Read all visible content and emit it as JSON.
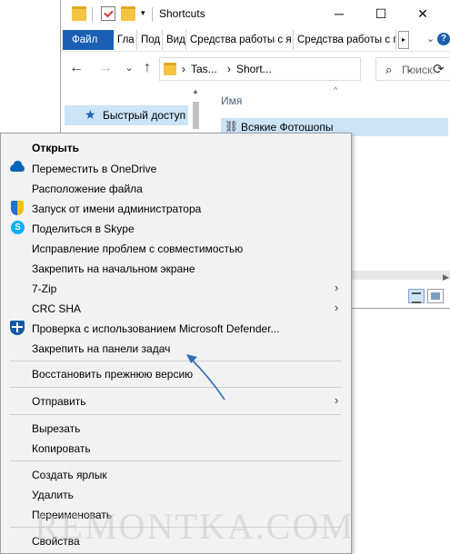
{
  "window": {
    "title": "Shortcuts",
    "minimize_glyph": "─",
    "maximize_glyph": "☐",
    "close_glyph": "✕",
    "dropdown_glyph": "▾"
  },
  "ribbon": {
    "tabs": [
      "Файл",
      "Гла",
      "Под",
      "Вид",
      "Средства работы с я",
      "Средства работы с п"
    ],
    "scroll_glyph": "▸",
    "collapse_glyph": "⌄",
    "help_glyph": "?"
  },
  "navigation": {
    "back_glyph": "←",
    "forward_glyph": "→",
    "history_glyph": "⌄",
    "up_glyph": "↑",
    "breadcrumb": [
      "Tas...",
      "Short..."
    ],
    "breadcrumb_sep": "›",
    "address_dropdown_glyph": "⌄",
    "refresh_glyph": "⟳",
    "search_placeholder": "Поиск:",
    "search_glyph": "⌕"
  },
  "nav_pane": {
    "quick_access": "Быстрый доступ"
  },
  "file_list": {
    "column_name": "Имя",
    "sort_glyph": "^",
    "selected_file": "Всякие Фотошопы"
  },
  "context_menu": {
    "items": [
      {
        "label": "Открыть",
        "icon": "",
        "submenu": false
      },
      {
        "label": "Переместить в OneDrive",
        "icon": "onedrive-icon",
        "submenu": false
      },
      {
        "label": "Расположение файла",
        "icon": "",
        "submenu": false
      },
      {
        "label": "Запуск от имени администратора",
        "icon": "uac-shield-icon",
        "submenu": false
      },
      {
        "label": "Поделиться в Skype",
        "icon": "skype-icon",
        "submenu": false
      },
      {
        "label": "Исправление проблем с совместимостью",
        "icon": "",
        "submenu": false
      },
      {
        "label": "Закрепить на начальном экране",
        "icon": "",
        "submenu": false
      },
      {
        "label": "7-Zip",
        "icon": "",
        "submenu": true
      },
      {
        "label": "CRC SHA",
        "icon": "",
        "submenu": true
      },
      {
        "label": "Проверка с использованием Microsoft Defender...",
        "icon": "defender-icon",
        "submenu": false
      },
      {
        "label": "Закрепить на панели задач",
        "icon": "",
        "submenu": false
      },
      {
        "label": "Восстановить прежнюю версию",
        "icon": "",
        "submenu": false
      },
      {
        "label": "Отправить",
        "icon": "",
        "submenu": true
      },
      {
        "label": "Вырезать",
        "icon": "",
        "submenu": false
      },
      {
        "label": "Копировать",
        "icon": "",
        "submenu": false
      },
      {
        "label": "Создать ярлык",
        "icon": "",
        "submenu": false
      },
      {
        "label": "Удалить",
        "icon": "",
        "submenu": false
      },
      {
        "label": "Переименовать",
        "icon": "",
        "submenu": false
      },
      {
        "label": "Свойства",
        "icon": "",
        "submenu": false
      }
    ],
    "submenu_glyph": "›",
    "skype_letter": "S"
  },
  "watermark": "REMONTKA.COM",
  "colors": {
    "accent": "#1a5fb4",
    "selection": "#cce4f7",
    "menu_bg": "#f2f2f2",
    "annotation_arrow": "#2f6fb5"
  }
}
